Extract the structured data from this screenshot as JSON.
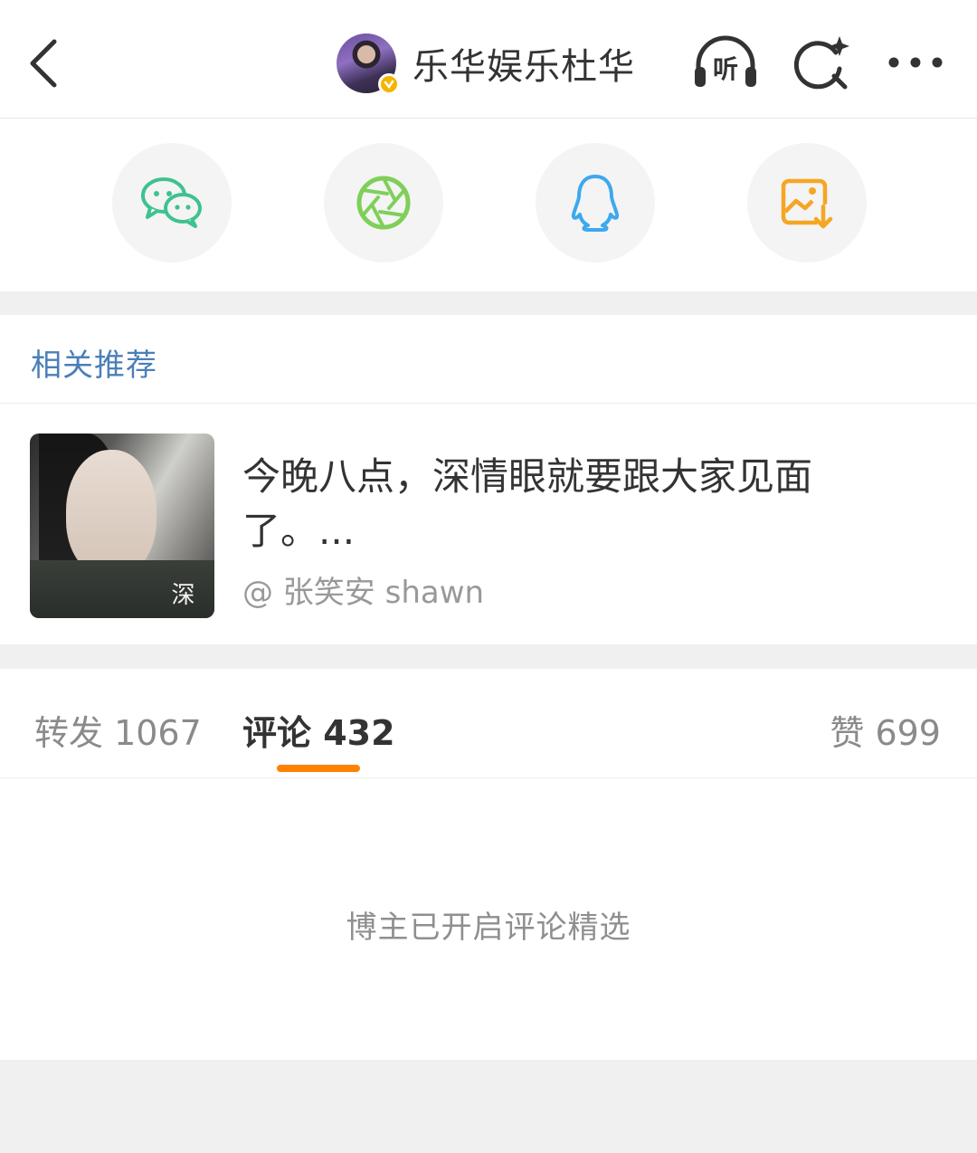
{
  "header": {
    "author_name": "乐华娱乐杜华",
    "verified_badge": "verified-badge-icon",
    "icons": {
      "back": "back-chevron-icon",
      "listen": "headphones-listen-icon",
      "listen_label": "听",
      "search": "search-sparkle-icon",
      "more": "more-dots-icon"
    }
  },
  "share": {
    "items": [
      {
        "name": "wechat",
        "icon": "wechat-icon",
        "color": "#3ec28f"
      },
      {
        "name": "moments",
        "icon": "moments-aperture-icon",
        "color": "#7fcf5a"
      },
      {
        "name": "qq",
        "icon": "qq-penguin-icon",
        "color": "#3ea8ee"
      },
      {
        "name": "save-image",
        "icon": "save-image-icon",
        "color": "#f5a623"
      }
    ]
  },
  "related": {
    "section_title": "相关推荐",
    "item": {
      "text": "今晚八点，深情眼就要跟大家见面了。...",
      "author": "@ 张笑安 shawn",
      "thumb_text": "深"
    }
  },
  "tabs": {
    "repost": "转发 1067",
    "comment": "评论 432",
    "like": "赞 699",
    "active": "comment",
    "accent_color": "#ff8200"
  },
  "comments": {
    "note": "博主已开启评论精选"
  }
}
